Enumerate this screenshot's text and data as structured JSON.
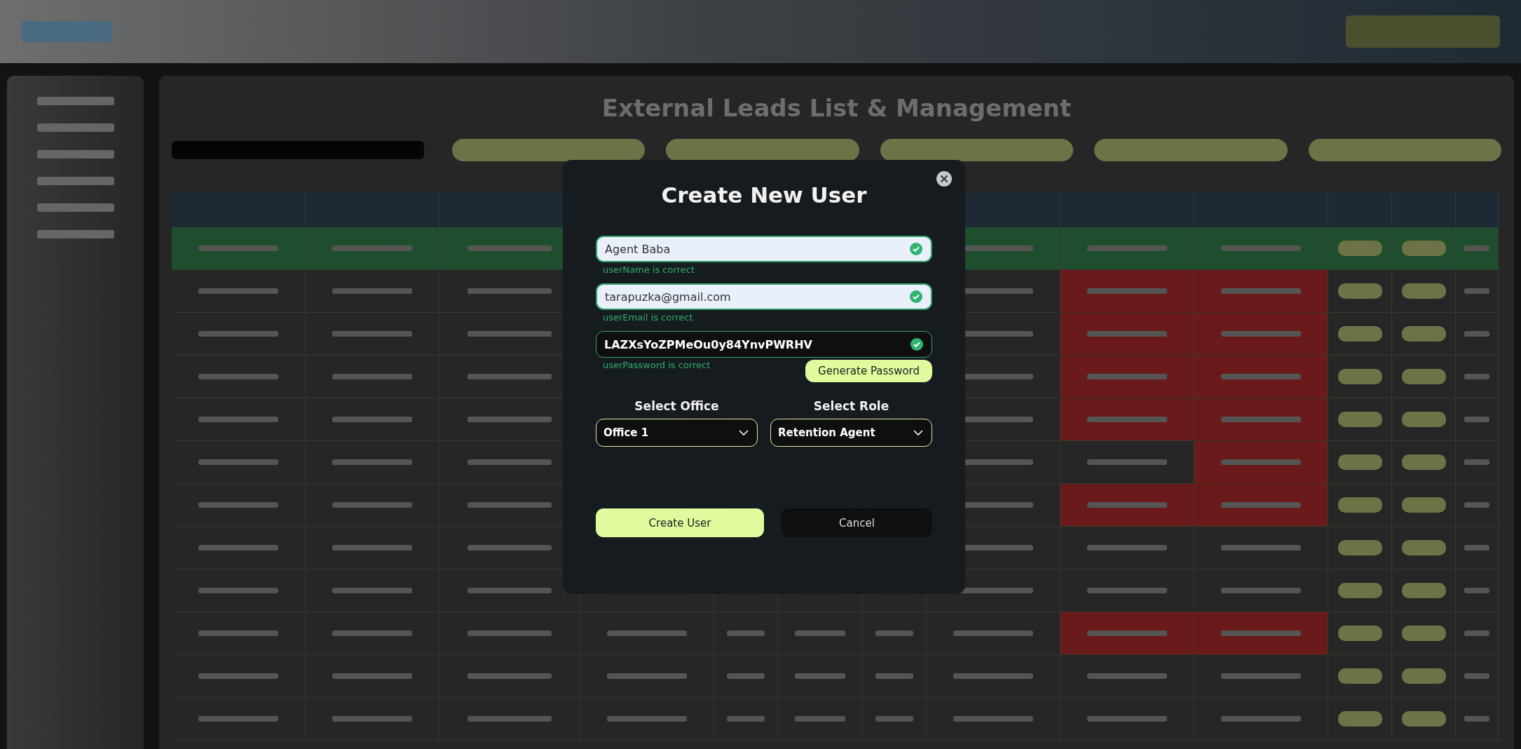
{
  "background": {
    "page_title": "External Leads List & Management"
  },
  "modal": {
    "title": "Create New User",
    "fields": [
      {
        "kind": "light",
        "value": "Agent Baba",
        "valid": true,
        "hint": "userName is correct"
      },
      {
        "kind": "light",
        "value": "tarapuzka@gmail.com",
        "valid": true,
        "hint": "userEmail is correct"
      },
      {
        "kind": "dark",
        "value": "LAZXsYoZPMeOu0y84YnvPWRHV",
        "valid": true,
        "hint": "userPassword is correct"
      }
    ],
    "generate_button": "Generate Password",
    "selects": [
      {
        "label": "Select Office",
        "value": "Office 1"
      },
      {
        "label": "Select Role",
        "value": "Retention Agent"
      }
    ],
    "buttons": [
      {
        "kind": "primary",
        "label": "Create User"
      },
      {
        "kind": "secondary",
        "label": "Cancel"
      }
    ]
  }
}
